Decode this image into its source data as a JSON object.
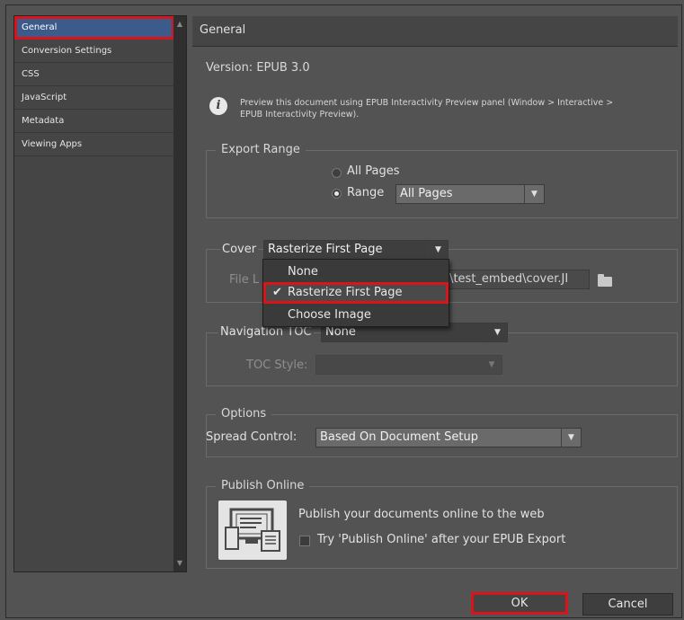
{
  "sidebar": {
    "items": [
      {
        "label": "General",
        "selected": true
      },
      {
        "label": "Conversion Settings"
      },
      {
        "label": "CSS"
      },
      {
        "label": "JavaScript"
      },
      {
        "label": "Metadata"
      },
      {
        "label": "Viewing Apps"
      }
    ]
  },
  "panel": {
    "title": "General",
    "version": "Version: EPUB 3.0",
    "info_line1": "Preview this document using EPUB Interactivity Preview panel (Window > Interactive >",
    "info_line2": "EPUB Interactivity Preview)."
  },
  "export_range": {
    "legend": "Export Range",
    "all_pages_label": "All Pages",
    "range_label": "Range",
    "range_value": "All Pages",
    "selected": "Range"
  },
  "cover": {
    "legend": "Cover",
    "value": "Rasterize First Page",
    "file_label": "File L",
    "file_value": ")\\test_embed\\cover.JI",
    "menu": [
      {
        "label": "None",
        "checked": false
      },
      {
        "label": "Rasterize First Page",
        "checked": true
      },
      {
        "label": "Choose Image",
        "checked": false
      }
    ],
    "check_glyph": "✔"
  },
  "navigation": {
    "legend": "Navigation TOC",
    "value": "None",
    "toc_style_label": "TOC Style:",
    "toc_style_value": ""
  },
  "options": {
    "legend": "Options",
    "spread_label": "Spread Control:",
    "spread_value": "Based On Document Setup"
  },
  "publish_online": {
    "legend": "Publish Online",
    "description": "Publish your documents online to the web",
    "checkbox_label": "Try 'Publish Online' after your EPUB Export",
    "checked": false
  },
  "buttons": {
    "ok": "OK",
    "cancel": "Cancel"
  },
  "colors": {
    "highlight": "#d9141a",
    "selection": "#3c5a8a"
  }
}
